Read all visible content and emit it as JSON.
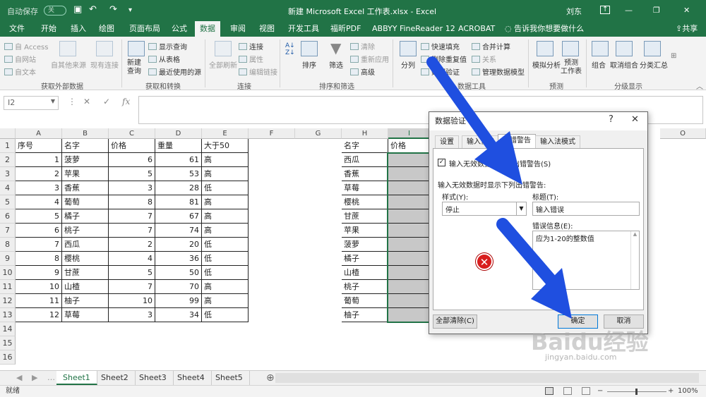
{
  "titlebar": {
    "autosave_label": "自动保存",
    "autosave_state": "关",
    "document_title": "新建 Microsoft Excel 工作表.xlsx  -  Excel",
    "user": "刘东",
    "minimize": "—",
    "restore": "❐",
    "close": "✕"
  },
  "tabs": [
    "文件",
    "开始",
    "插入",
    "绘图",
    "页面布局",
    "公式",
    "数据",
    "审阅",
    "视图",
    "开发工具",
    "福昕PDF",
    "ABBYY FineReader 12",
    "ACROBAT",
    "告诉我你想要做什么"
  ],
  "share_label": "共享",
  "ribbon": {
    "external": {
      "access": "自 Access",
      "web": "自网站",
      "text": "自文本",
      "other": "自其他来源",
      "existing": "现有连接",
      "group": "获取外部数据"
    },
    "transform": {
      "new_query": "新建\n查询",
      "show_queries": "显示查询",
      "from_table": "从表格",
      "recent": "最近使用的源",
      "group": "获取和转换"
    },
    "connections": {
      "refresh_all": "全部刷新",
      "connections": "连接",
      "properties": "属性",
      "edit_links": "编辑链接",
      "group": "连接"
    },
    "sort_filter": {
      "sort": "排序",
      "filter": "筛选",
      "clear": "清除",
      "reapply": "重新应用",
      "advanced": "高级",
      "group": "排序和筛选"
    },
    "data_tools": {
      "split": "分列",
      "flash_fill": "快速填充",
      "remove_dup": "删除重复值",
      "validation": "数据验证",
      "consolidate": "合并计算",
      "relations": "关系",
      "model": "管理数据模型",
      "group": "数据工具"
    },
    "forecast": {
      "whatif": "模拟分析",
      "sheet": "预测\n工作表",
      "group": "预测"
    },
    "outline": {
      "group_btn": "组合",
      "ungroup": "取消组合",
      "subtotal": "分类汇总",
      "group": "分级显示"
    }
  },
  "formula_bar": {
    "name_box": "I2",
    "fx": "fx"
  },
  "columns": [
    "A",
    "B",
    "C",
    "D",
    "E",
    "F",
    "G",
    "H",
    "I",
    "O"
  ],
  "rows": [
    "1",
    "2",
    "3",
    "4",
    "5",
    "6",
    "7",
    "8",
    "9",
    "10",
    "11",
    "12",
    "13",
    "14",
    "15",
    "16"
  ],
  "table": {
    "headers": [
      "序号",
      "名字",
      "价格",
      "重量",
      "大于50"
    ],
    "rows": [
      [
        "1",
        "菠萝",
        "6",
        "61",
        "高"
      ],
      [
        "2",
        "苹果",
        "5",
        "53",
        "高"
      ],
      [
        "3",
        "香蕉",
        "3",
        "28",
        "低"
      ],
      [
        "4",
        "葡萄",
        "8",
        "81",
        "高"
      ],
      [
        "5",
        "橘子",
        "7",
        "67",
        "高"
      ],
      [
        "6",
        "桃子",
        "7",
        "74",
        "高"
      ],
      [
        "7",
        "西瓜",
        "2",
        "20",
        "低"
      ],
      [
        "8",
        "樱桃",
        "4",
        "36",
        "低"
      ],
      [
        "9",
        "甘蔗",
        "5",
        "50",
        "低"
      ],
      [
        "10",
        "山楂",
        "7",
        "70",
        "高"
      ],
      [
        "11",
        "柚子",
        "10",
        "99",
        "高"
      ],
      [
        "12",
        "草莓",
        "3",
        "34",
        "低"
      ]
    ]
  },
  "table2": {
    "headers": [
      "名字",
      "价格"
    ],
    "names": [
      "西瓜",
      "香蕉",
      "草莓",
      "樱桃",
      "甘蔗",
      "苹果",
      "菠萝",
      "橘子",
      "山楂",
      "桃子",
      "葡萄",
      "柚子"
    ]
  },
  "sheets": [
    "Sheet1",
    "Sheet2",
    "Sheet3",
    "Sheet4",
    "Sheet5"
  ],
  "status": {
    "ready": "就绪",
    "zoom": "100%"
  },
  "dialog": {
    "title": "数据验证",
    "help": "?",
    "close": "✕",
    "tabs": [
      "设置",
      "输入信息",
      "出错警告",
      "输入法模式"
    ],
    "checkbox_label": "输入无效数据时显示出错警告(S)",
    "section_label": "输入无效数据时显示下列出错警告:",
    "style_label": "样式(Y):",
    "style_value": "停止",
    "title_label": "标题(T):",
    "title_value": "输入错误",
    "message_label": "错误信息(E):",
    "message_value": "应为1-20的整数值",
    "clear_all": "全部清除(C)",
    "ok": "确定",
    "cancel": "取消"
  },
  "watermark": "Baidu经验",
  "watermark_url": "jingyan.baidu.com",
  "colors": {
    "excel_green": "#217346",
    "arrow_blue": "#1f4fe0",
    "selection_gray": "#c8c8c8"
  }
}
